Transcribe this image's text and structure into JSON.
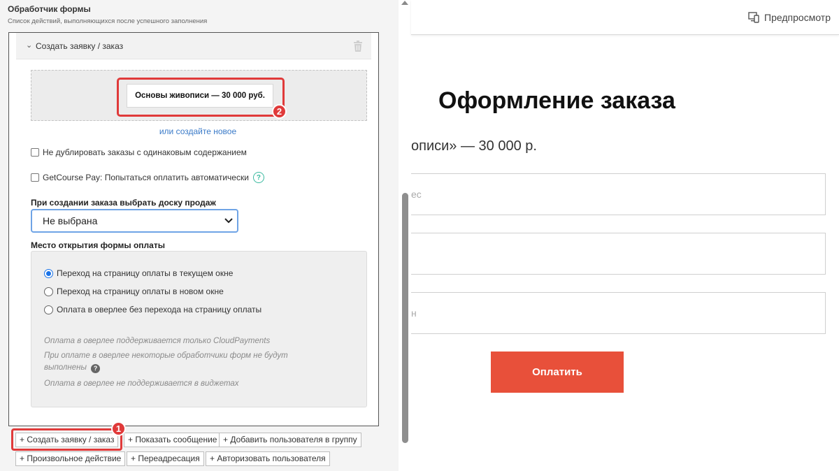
{
  "panel": {
    "title": "Обработчик формы",
    "subtitle": "Список действий, выполняющихся после успешного заполнения"
  },
  "action": {
    "title": "Создать заявку / заказ",
    "offer": "Основы живописи — 30 000 руб.",
    "create_new_link": "или создайте новое",
    "checkbox_no_duplicate": "Не дублировать заказы с одинаковым содержанием",
    "checkbox_autopay": "GetCourse Pay: Попытаться оплатить автоматически",
    "board_label": "При создании заказа выбрать доску продаж",
    "board_value": "Не выбрана",
    "payment_label": "Место открытия формы оплаты",
    "payment_options": [
      {
        "label": "Переход на страницу оплаты в текущем окне",
        "checked": true
      },
      {
        "label": "Переход на страницу оплаты в новом окне",
        "checked": false
      },
      {
        "label": "Оплата в оверлее без перехода на страницу оплаты",
        "checked": false
      }
    ],
    "notes": [
      "Оплата в оверлее поддерживается только CloudPayments",
      "При оплате в оверлее некоторые обработчики форм не будут выполнены",
      "Оплата в оверлее не поддерживается в виджетах"
    ]
  },
  "add_buttons": {
    "create_order": "+ Создать заявку / заказ",
    "show_message": "+ Показать сообщение",
    "add_to_group": "+ Добавить пользователя в группу",
    "custom_action": "+ Произвольное действие",
    "redirect": "+ Переадресация",
    "authorize": "+ Авторизовать пользователя"
  },
  "annotations": {
    "badge1": "1",
    "badge2": "2",
    "color": "#e03a3a"
  },
  "preview": {
    "button": "Предпросмотр",
    "title": "Оформление заказа",
    "subtitle": "описи» — 30 000 р.",
    "field1_placeholder": "ес",
    "field3_placeholder": "н",
    "pay_button": "Оплатить",
    "pay_color": "#e8503a"
  },
  "icons": [
    "chevron-down-icon",
    "trash-icon",
    "help-icon",
    "question-icon",
    "select-arrow-icon",
    "preview-device-icon"
  ]
}
